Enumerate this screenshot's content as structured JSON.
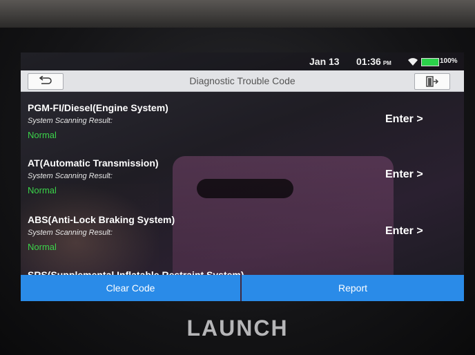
{
  "status_bar": {
    "date": "Jan 13",
    "time": "01:36",
    "ampm": "PM",
    "battery": "100%",
    "wifi_icon": "wifi-icon",
    "battery_icon": "battery-icon"
  },
  "header": {
    "title": "Diagnostic Trouble Code",
    "back_icon": "back-arrow-icon",
    "exit_icon": "exit-icon"
  },
  "systems": [
    {
      "name": "PGM-FI/Diesel(Engine System)",
      "label": "System Scanning Result:",
      "status": "Normal",
      "action": "Enter >"
    },
    {
      "name": "AT(Automatic Transmission)",
      "label": "System Scanning Result:",
      "status": "Normal",
      "action": "Enter >"
    },
    {
      "name": "ABS(Anti-Lock Braking System)",
      "label": "System Scanning Result:",
      "status": "Normal",
      "action": "Enter >"
    }
  ],
  "partial_system": "SRS(Supplemental Inflatable Restraint System)",
  "buttons": {
    "clear": "Clear Code",
    "report": "Report"
  },
  "brand": "LAUNCH",
  "colors": {
    "accent": "#2a8be8",
    "status_normal": "#3bd34a",
    "title_bar": "#e2e3e6"
  }
}
